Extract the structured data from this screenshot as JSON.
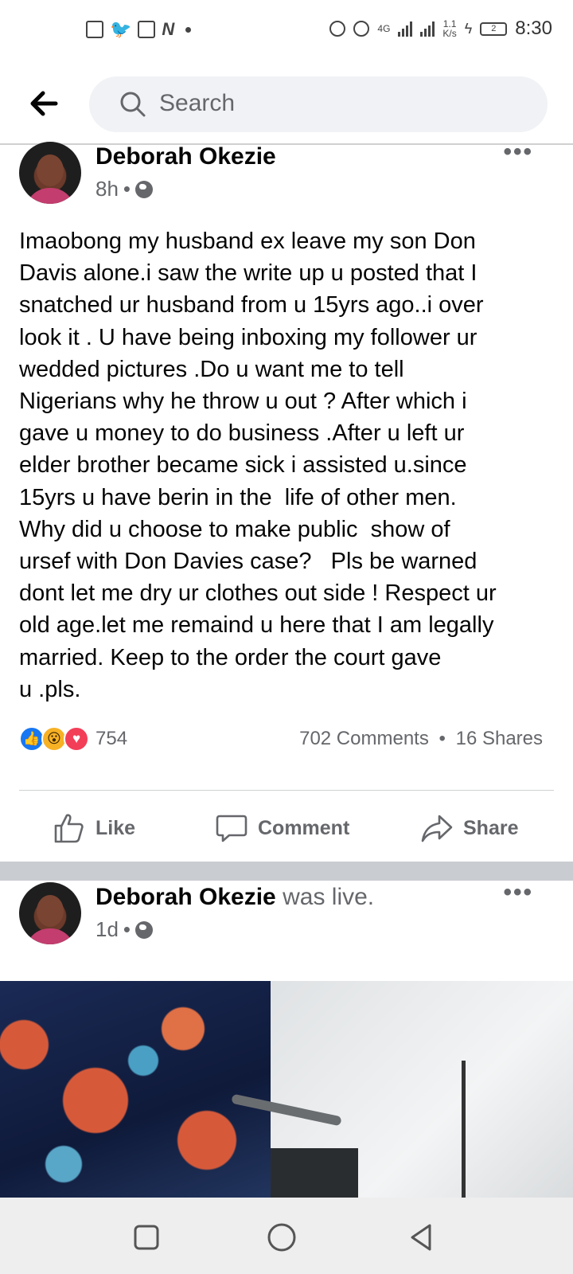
{
  "status_bar": {
    "time": "8:30",
    "network_type": "4G",
    "data_speed_value": "1.1",
    "data_speed_unit": "K/s",
    "battery_level": "2"
  },
  "header": {
    "search_placeholder": "Search"
  },
  "posts": [
    {
      "author": "Deborah Okezie",
      "author_suffix": "",
      "time_ago": "8h",
      "audience_icon": "globe-icon",
      "text": "Imaobong my husband ex leave my son Don\nDavis alone.i saw the write up u posted that I\nsnatched ur husband from u 15yrs ago..i over\nlook it . U have being inboxing my follower ur\nwedded pictures .Do u want me to tell\nNigerians why he throw u out ? After which i\ngave u money to do business .After u left ur\nelder brother became sick i assisted u.since\n15yrs u have berin in the  life of other men.\nWhy did u choose to make public  show of\nursef with Don Davies case?   Pls be warned\ndont let me dry ur clothes out side ! Respect ur\nold age.let me remaind u here that I am legally\nmarried. Keep to the order the court gave\nu .pls.",
      "reaction_count": "754",
      "comments": "702 Comments",
      "separator": "•",
      "shares": "16 Shares",
      "actions": {
        "like": "Like",
        "comment": "Comment",
        "share": "Share"
      }
    },
    {
      "author": "Deborah Okezie",
      "author_suffix": "was live.",
      "time_ago": "1d",
      "audience_icon": "globe-icon"
    }
  ],
  "colors": {
    "facebook_blue": "#1877f2",
    "secondary_text": "#65676b",
    "search_bg": "#f0f2f5",
    "divider_band": "#c9ccd1"
  }
}
